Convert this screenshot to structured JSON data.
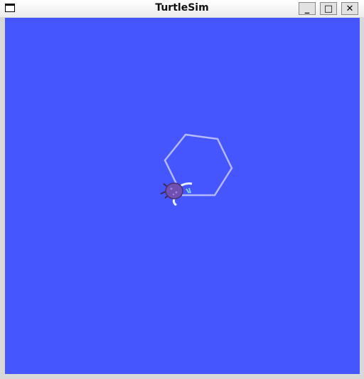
{
  "window": {
    "title": "TurtleSim",
    "minimize_label": "_",
    "maximize_label": "□",
    "close_label": "✕"
  },
  "canvas": {
    "background": "#4556ff",
    "pen_color": "#b3b8ff",
    "path_shape": "hexagon"
  }
}
